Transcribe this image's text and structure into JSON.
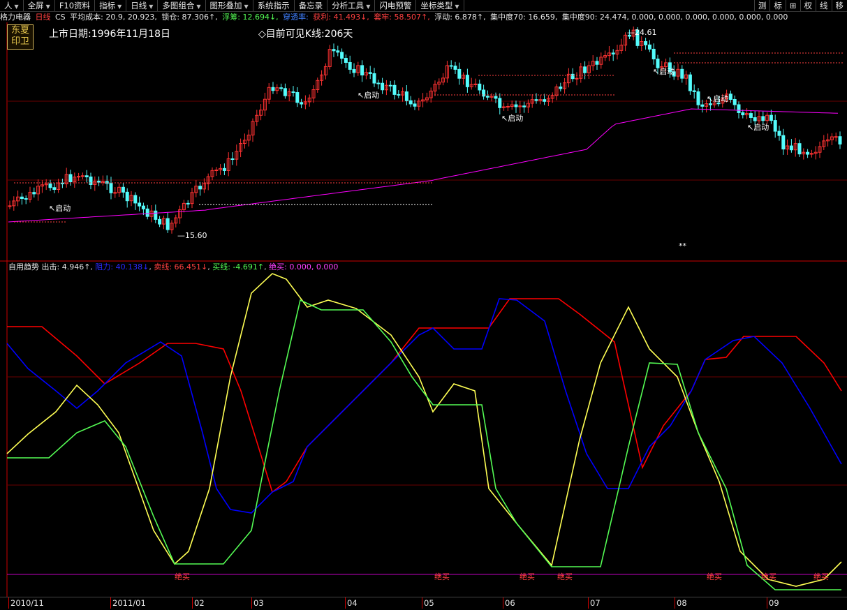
{
  "toolbar": {
    "items": [
      "人",
      "全屏",
      "F10资料",
      "指标",
      "日线",
      "多图组合",
      "图形叠加",
      "系统指示",
      "备忘录",
      "分析工具",
      "闪电预警",
      "坐标类型"
    ],
    "right": [
      "测",
      "标",
      "权",
      "线",
      "移"
    ]
  },
  "info": {
    "stock": "格力电器",
    "period": "日线",
    "label_cs": "CS",
    "avg_cost": "平均成本: 20.9, 20.923,",
    "lock": "锁仓: 87.306↑,",
    "float_chips": "浮筹: 12.694↓,",
    "penetration": "穿透率:",
    "profit": "获利: 41.493↓,",
    "trapped": "套牢: 58.507↑,",
    "floating": "浮动: 6.878↑,",
    "conc70": "集中度70: 16.659,",
    "conc90": "集中度90: 24.474, 0.000, 0.000, 0.000, 0.000, 0.000, 0.000"
  },
  "main": {
    "logo": "东夏 印卫",
    "listing_date": "上市日期:1996年11月18日",
    "visible_k": "◇目前可见K线:206天",
    "high_label": "24.61",
    "low_label": "15.60",
    "start_labels": [
      "↖启动",
      "↖启动",
      "↖启动",
      "↖启动",
      "↖启动",
      "↖启动"
    ],
    "star_marker": "**"
  },
  "indicator": {
    "name": "自用趋势",
    "out": "出击: 4.946↑",
    "resist": "阻力: 40.138↓",
    "sell_line": "卖线: 66.451↓",
    "buy_line": "买线: -4.691↑",
    "absolute_buy": "绝买: 0.000, 0.000",
    "buy_labels": [
      "绝买",
      "绝买",
      "绝买",
      "绝买",
      "绝买",
      "绝买",
      "绝买"
    ]
  },
  "xaxis": {
    "labels": [
      "2010/11",
      "2011/01",
      "02",
      "03",
      "04",
      "05",
      "06",
      "07",
      "08",
      "09"
    ]
  },
  "colors": {
    "bg": "#000000",
    "up": "#ff3232",
    "down": "#54fcfc",
    "ma": "#ff00ff",
    "yellow": "#ffff54",
    "green": "#54fc54",
    "blue": "#0000ff",
    "red": "#ff0000"
  }
}
